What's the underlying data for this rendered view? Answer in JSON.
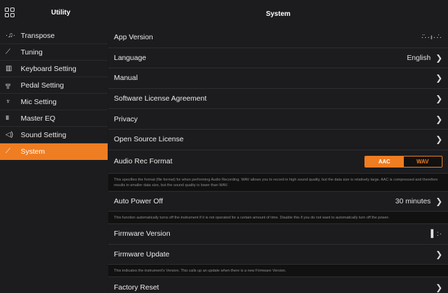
{
  "sidebar": {
    "title": "Utility",
    "items": [
      {
        "label": "Transpose",
        "icon": "transpose-icon",
        "glyph": "·♫·",
        "active": false
      },
      {
        "label": "Tuning",
        "icon": "tuning-fork-icon",
        "glyph": "⟋",
        "active": false
      },
      {
        "label": "Keyboard Setting",
        "icon": "keyboard-icon",
        "glyph": "▥",
        "active": false
      },
      {
        "label": "Pedal Setting",
        "icon": "pedal-icon",
        "glyph": "╦",
        "active": false
      },
      {
        "label": "Mic Setting",
        "icon": "microphone-icon",
        "glyph": "♆",
        "active": false
      },
      {
        "label": "Master EQ",
        "icon": "equalizer-icon",
        "glyph": "⩩",
        "active": false
      },
      {
        "label": "Sound Setting",
        "icon": "speaker-icon",
        "glyph": "◁)",
        "active": false
      },
      {
        "label": "System",
        "icon": "wrench-icon",
        "glyph": "⟋",
        "active": true
      }
    ]
  },
  "main": {
    "title": "System",
    "rows": {
      "app_version": {
        "label": "App Version",
        "value": "·̈··ı··̇·"
      },
      "language": {
        "label": "Language",
        "value": "English"
      },
      "manual": {
        "label": "Manual"
      },
      "software_license": {
        "label": "Software License Agreement"
      },
      "privacy": {
        "label": "Privacy"
      },
      "open_source": {
        "label": "Open Source License"
      },
      "audio_rec_format": {
        "label": "Audio Rec Format",
        "options": [
          "AAC",
          "WAV"
        ],
        "selected": "AAC"
      },
      "audio_rec_desc": "This specifies the format (file format) for when performing Audio Recording. WAV allows you to record in high sound quality, but the data size is relatively large. AAC is compressed and therefore results in smaller data size, but the sound quality is lower than WAV.",
      "auto_power_off": {
        "label": "Auto Power Off",
        "value": "30 minutes"
      },
      "auto_power_desc": "This function automatically turns off the instrument if it is not operated for a certain amount of time. Disable this if you do not want to automatically turn off the power.",
      "firmware_version": {
        "label": "Firmware Version",
        "value": "▌:·"
      },
      "firmware_update": {
        "label": "Firmware Update"
      },
      "firmware_desc": "This indicates the instrument's Version. This calls up an update when there is a new Firmware Version.",
      "factory_reset": {
        "label": "Factory Reset"
      }
    }
  },
  "colors": {
    "accent": "#ef7d22",
    "panel": "#1c1c1e",
    "background": "#000000"
  }
}
